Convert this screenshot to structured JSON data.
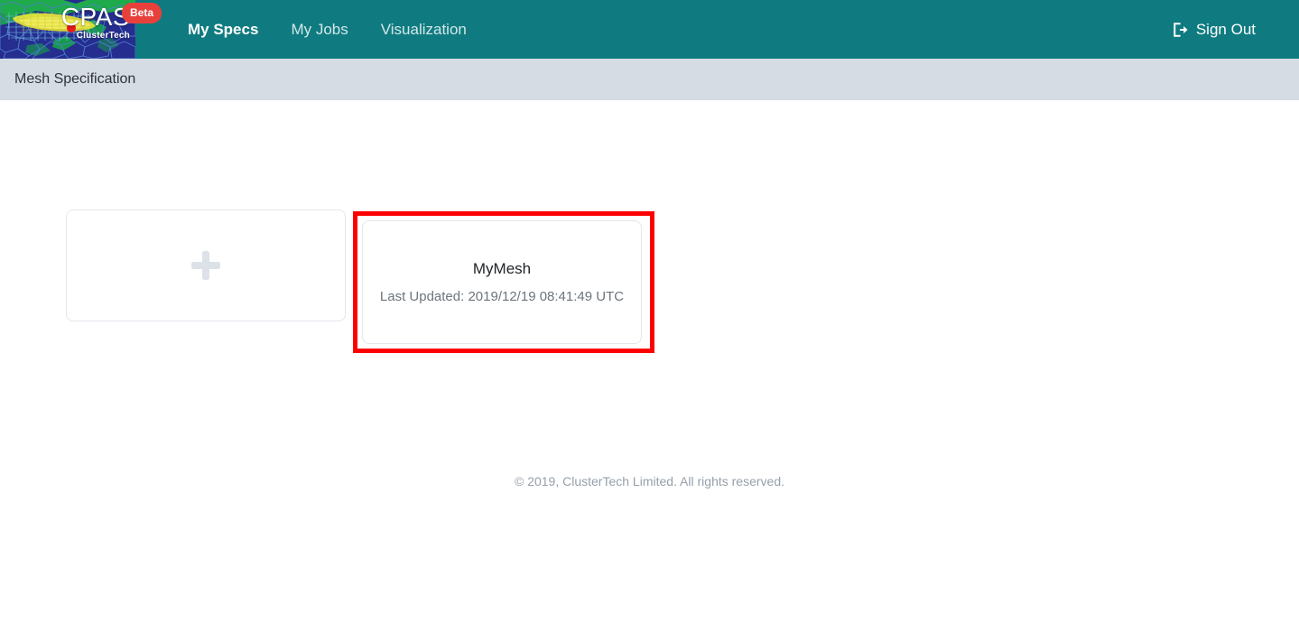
{
  "header": {
    "brand": {
      "name": "CPAS",
      "subtitle": "ClusterTech",
      "badge": "Beta",
      "logo_icon": "mesh-map-logo"
    },
    "nav": [
      {
        "label": "My Specs",
        "active": true
      },
      {
        "label": "My Jobs",
        "active": false
      },
      {
        "label": "Visualization",
        "active": false
      }
    ],
    "signout": {
      "label": "Sign Out",
      "icon": "sign-out-icon"
    },
    "colors": {
      "background": "#0f7b80",
      "badge": "#e8413c",
      "logo_background": "#252d8f"
    }
  },
  "subheader": {
    "title": "Mesh Specification",
    "background": "#d6dce4"
  },
  "main": {
    "add_card": {
      "icon": "plus-icon",
      "label": ""
    },
    "spec_cards": [
      {
        "title": "MyMesh",
        "subtitle": "Last Updated: 2019/12/19 08:41:49 UTC",
        "highlighted": true,
        "highlight_color": "#fe0000"
      }
    ]
  },
  "footer": {
    "text": "© 2019, ClusterTech Limited. All rights reserved."
  }
}
